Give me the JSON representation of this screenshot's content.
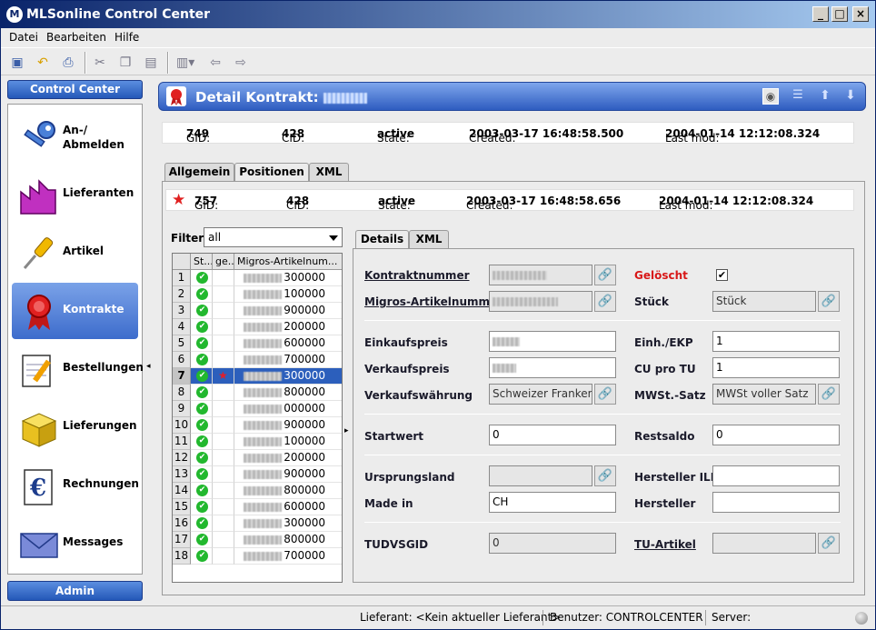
{
  "window": {
    "title": "MLSonline Control Center",
    "app_icon": "M"
  },
  "menu": {
    "file": "Datei",
    "edit": "Bearbeiten",
    "help": "Hilfe"
  },
  "sidebar": {
    "header": "Control Center",
    "items": [
      {
        "label": "An-/ Abmelden",
        "icon": "key-icon"
      },
      {
        "label": "Lieferanten",
        "icon": "factory-icon"
      },
      {
        "label": "Artikel",
        "icon": "screwdriver-icon"
      },
      {
        "label": "Kontrakte",
        "icon": "ribbon-icon",
        "selected": true
      },
      {
        "label": "Bestellungen",
        "icon": "notepad-icon"
      },
      {
        "label": "Lieferungen",
        "icon": "box-icon"
      },
      {
        "label": "Rechnungen",
        "icon": "euro-icon"
      },
      {
        "label": "Messages",
        "icon": "envelope-icon"
      }
    ],
    "admin": "Admin"
  },
  "detail": {
    "title": "Detail Kontrakt:"
  },
  "contract_info": {
    "gid_label": "GID:",
    "gid": "749",
    "cid_label": "CID:",
    "cid": "428",
    "state_label": "State:",
    "state": "active",
    "created_label": "Created:",
    "created": "2003-03-17 16:48:58.500",
    "lastmod_label": "Last mod:",
    "lastmod": "2004-01-14 12:12:08.324"
  },
  "main_tabs": [
    "Allgemein",
    "Positionen",
    "XML"
  ],
  "position_info": {
    "gid_label": "GID:",
    "gid": "757",
    "cid_label": "CID:",
    "cid": "428",
    "state_label": "State:",
    "state": "active",
    "created_label": "Created:",
    "created": "2003-03-17 16:48:58.656",
    "lastmod_label": "Last mod:",
    "lastmod": "2004-01-14 12:12:08.324"
  },
  "filter": {
    "label": "Filter",
    "value": "all"
  },
  "table": {
    "columns": [
      "St...",
      "ge...",
      "Migros-Artikelnum..."
    ],
    "rows": [
      {
        "n": "1",
        "num": "300000"
      },
      {
        "n": "2",
        "num": "100000"
      },
      {
        "n": "3",
        "num": "900000"
      },
      {
        "n": "4",
        "num": "200000"
      },
      {
        "n": "5",
        "num": "600000"
      },
      {
        "n": "6",
        "num": "700000"
      },
      {
        "n": "7",
        "num": "300000",
        "selected": true,
        "deleted": true
      },
      {
        "n": "8",
        "num": "800000"
      },
      {
        "n": "9",
        "num": "000000"
      },
      {
        "n": "10",
        "num": "900000"
      },
      {
        "n": "11",
        "num": "100000"
      },
      {
        "n": "12",
        "num": "200000"
      },
      {
        "n": "13",
        "num": "900000"
      },
      {
        "n": "14",
        "num": "800000"
      },
      {
        "n": "15",
        "num": "600000"
      },
      {
        "n": "16",
        "num": "300000"
      },
      {
        "n": "17",
        "num": "800000"
      },
      {
        "n": "18",
        "num": "700000"
      }
    ]
  },
  "detail_tabs": [
    "Details",
    "XML"
  ],
  "form": {
    "kontraktnummer": "Kontraktnummer",
    "migros_nr": "Migros-Artikelnummer",
    "geloescht": "Gelöscht",
    "geloescht_checked": "✔",
    "stueck": "Stück",
    "stueck_value": "Stück",
    "einkaufspreis": "Einkaufspreis",
    "verkaufspreis": "Verkaufspreis",
    "verkaufswaehrung": "Verkaufswährung",
    "verkaufswaehrung_value": "Schweizer Franken",
    "einh_ekp": "Einh./EKP",
    "einh_ekp_value": "1",
    "cu_pro_tu": "CU pro TU",
    "cu_pro_tu_value": "1",
    "mwst": "MWSt.-Satz",
    "mwst_value": "MWSt voller Satz",
    "startwert": "Startwert",
    "startwert_value": "0",
    "restsaldo": "Restsaldo",
    "restsaldo_value": "0",
    "ursprungsland": "Ursprungsland",
    "made_in": "Made in",
    "made_in_value": "CH",
    "hersteller_iln": "Hersteller ILN",
    "hersteller": "Hersteller",
    "tudvsgid": "TUDVSGID",
    "tudvsgid_value": "0",
    "tu_artikel": "TU-Artikel"
  },
  "status": {
    "lieferant": "Lieferant:  <Kein aktueller Lieferant>",
    "benutzer": "Benutzer:  CONTROLCENTER",
    "server": "Server:"
  }
}
